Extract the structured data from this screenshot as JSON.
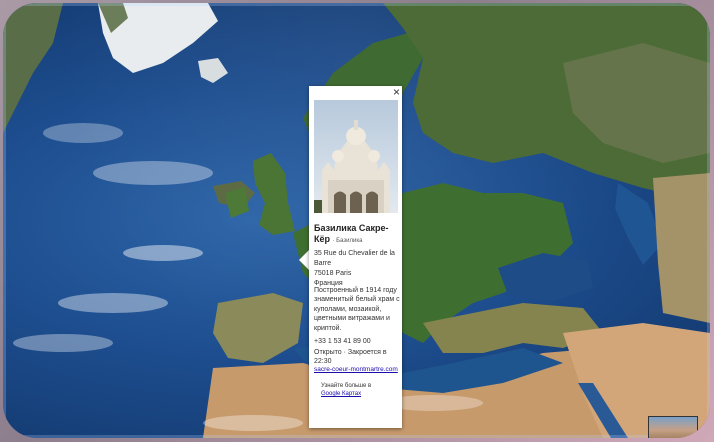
{
  "place_card": {
    "title": "Базилика Сакре-Кёр",
    "category": "· Базилика",
    "address": [
      "35 Rue du Chevalier de la Barre",
      "75018 Paris",
      "Франция"
    ],
    "description": "Построенный в 1914 году знаменитый белый храм с куполами, мозаикой, цветными витражами и криптой.",
    "phone": "+33 1 53 41 89 00",
    "hours_status": "Открыто",
    "hours_separator": "·",
    "hours_detail": "Закроется в 22:30",
    "website": "sacre-coeur-montmartre.com",
    "more_prefix": "Узнайте больше в",
    "more_link": "Google Картах",
    "close_symbol": "×"
  }
}
